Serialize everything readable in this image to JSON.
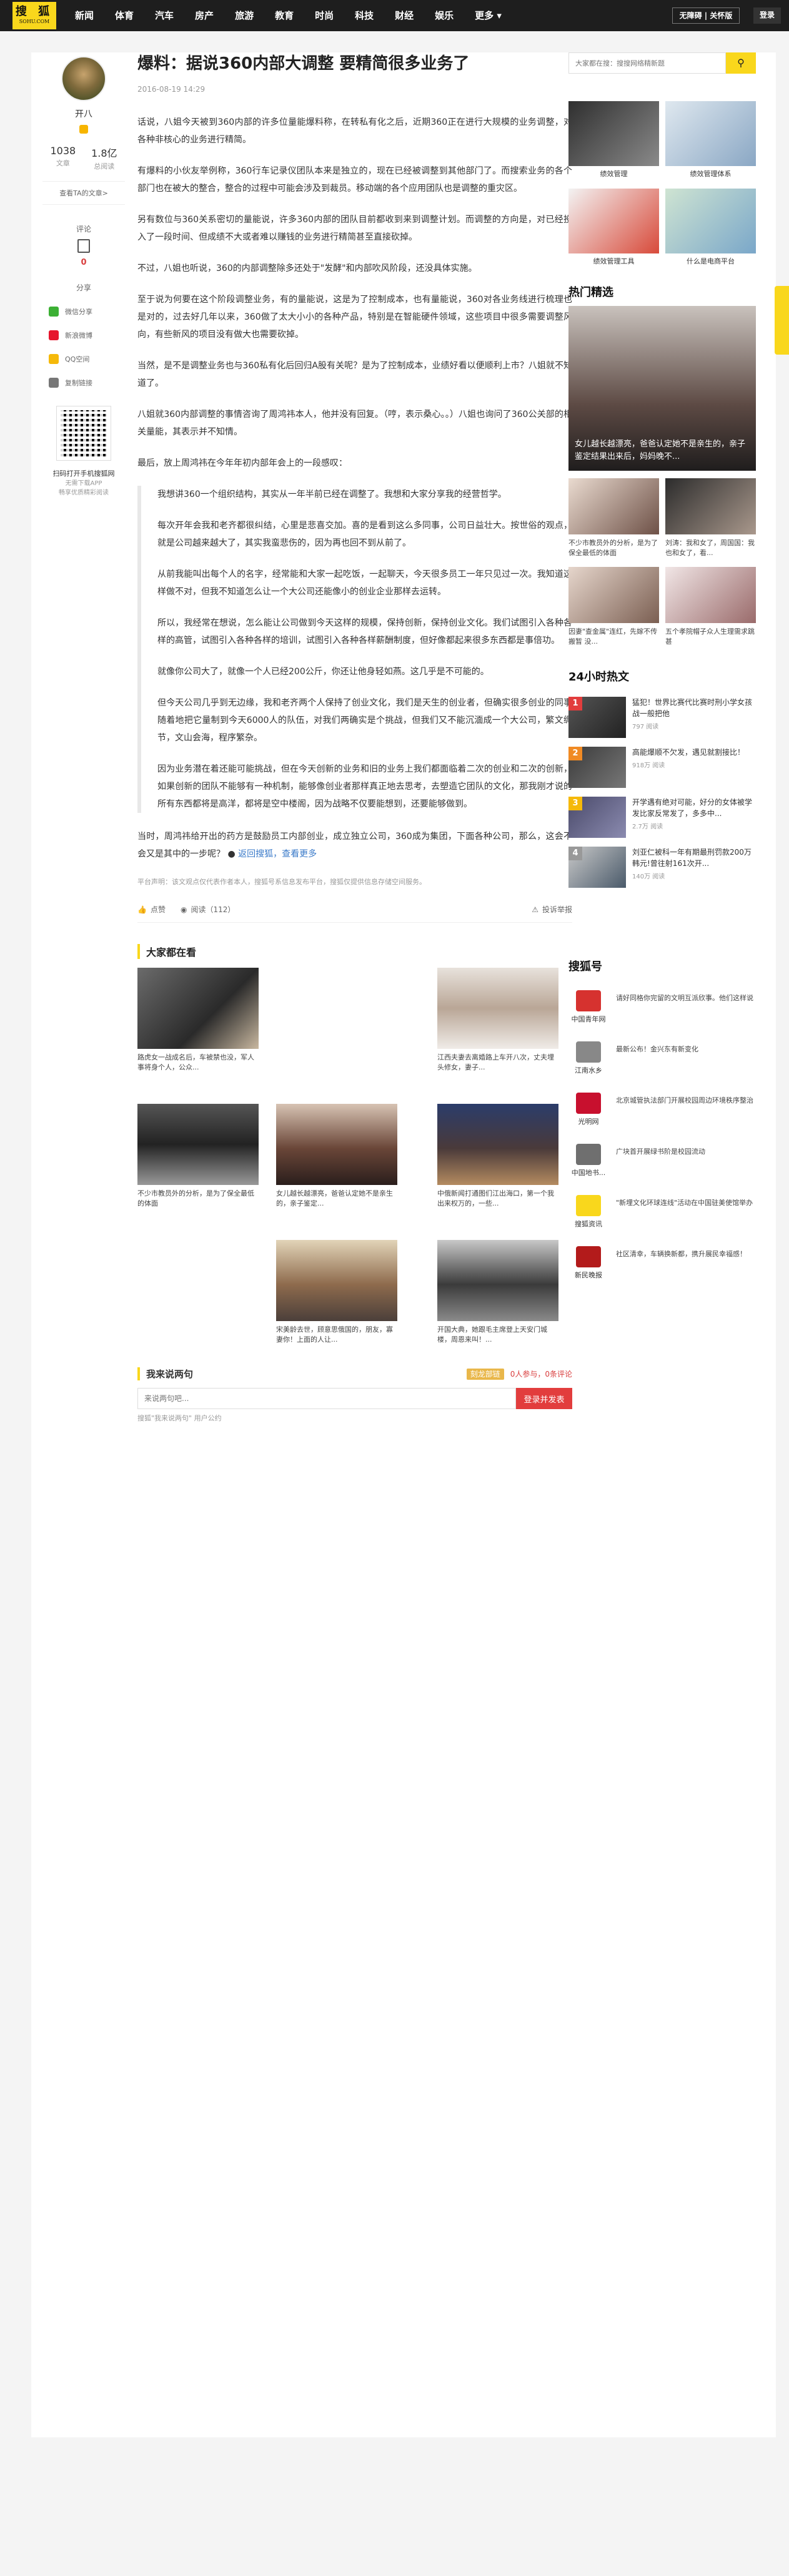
{
  "nav": {
    "logo_line1": "搜 狐",
    "logo_line2": "SOHU.COM",
    "items": [
      "新闻",
      "体育",
      "汽车",
      "房产",
      "旅游",
      "教育",
      "时尚",
      "科技",
      "财经",
      "娱乐",
      "更多"
    ],
    "kids_mode": "无障碍 | 关怀版",
    "login": "登录"
  },
  "author": {
    "name": "开八",
    "articles": "1038",
    "articles_label": "文章",
    "reads": "1.8亿",
    "reads_label": "总阅读",
    "more_articles": "查看TA的文章>"
  },
  "side": {
    "comment_label": "评论",
    "comment_count": "0",
    "share_label": "分享",
    "share_items": [
      "微信分享",
      "新浪微博",
      "QQ空间",
      "复制链接"
    ],
    "qr_text": "扫码打开手机搜狐网",
    "qr_sub1": "无需下载APP",
    "qr_sub2": "畅享优质精彩阅读"
  },
  "article": {
    "title": "爆料：据说360内部大调整 要精简很多业务了",
    "date": "2016-08-19 14:29",
    "paragraphs": [
      "话说，八姐今天被到360内部的许多位量能爆料称，在转私有化之后，近期360正在进行大规模的业务调整，对各种非核心的业务进行精简。",
      "有爆料的小伙友举例称，360行车记录仪团队本来是独立的，现在已经被调整到其他部门了。而搜索业务的各个部门也在被大的整合，整合的过程中可能会涉及到裁员。移动端的各个应用团队也是调整的重灾区。",
      "另有数位与360关系密切的量能说，许多360内部的团队目前都收到来到调整计划。而调整的方向是，对已经投入了一段时间、但成绩不大或者难以赚钱的业务进行精简甚至直接砍掉。",
      "不过，八姐也听说，360的内部调整除多还处于\"发酵\"和内部吹风阶段，还没具体实施。",
      "至于说为何要在这个阶段调整业务，有的量能说，这是为了控制成本，也有量能说，360对各业务线进行梳理也是对的，过去好几年以来，360做了太大小小的各种产品，特别是在智能硬件领域，这些项目中很多需要调整风向，有些新风的项目没有做大也需要砍掉。",
      "当然，是不是调整业务也与360私有化后回归A股有关呢？是为了控制成本，业绩好看以便顺利上市？八姐就不知道了。",
      "八姐就360内部调整的事情咨询了周鸿祎本人，他并没有回复。（哼，表示桑心。。）八姐也询问了360公关部的相关量能，其表示并不知情。",
      "最后，放上周鸿祎在今年年初内部年会上的一段感叹："
    ],
    "quote": [
      "我想讲360一个组织结构，其实从一年半前已经在调整了。我想和大家分享我的经营哲学。",
      "每次开年会我和老齐都很纠结，心里是悲喜交加。喜的是看到这么多同事，公司日益壮大。按世俗的观点，就是公司越来越大了，其实我蛮悲伤的，因为再也回不到从前了。",
      "从前我能叫出每个人的名字，经常能和大家一起吃饭，一起聊天，今天很多员工一年只见过一次。我知道这样做不对，但我不知道怎么让一个大公司还能像小的创业企业那样去运转。",
      "所以，我经常在想说，怎么能让公司做到今天这样的规模，保持创新，保持创业文化。我们试图引入各种各样的高管，试图引入各种各样的培训，试图引入各种各样薪酬制度，但好像都起来很多东西都是事倍功。",
      "就像你公司大了，就像一个人已经200公斤，你还让他身轻如燕。这几乎是不可能的。",
      "但今天公司几乎到无边缘，我和老齐两个人保持了创业文化，我们是天生的创业者，但确实很多创业的同事随着地把它量制到今天6000人的队伍，对我们两确实是个挑战，但我们又不能沉湎成一个大公司，繁文缛节，文山会海，程序繁杂。",
      "因为业务潜在着还能可能挑战，但在今天创新的业务和旧的业务上我们都面临着二次的创业和二次的创新，如果创新的团队不能够有一种机制，能够像创业者那样真正地去思考，去塑造它团队的文化，那我刚才说的所有东西都将是高洋，都将是空中楼阁，因为战略不仅要能想到，还要能够做到。"
    ],
    "final": "当时，周鸿祎给开出的药方是鼓励员工内部创业，成立独立公司，360成为集团，下面各种公司，那么，这会不会又是其中的一步呢？",
    "link1": "返回搜狐，查看更多",
    "disclaimer": "平台声明：该文观点仅代表作者本人，搜狐号系信息发布平台，搜狐仅提供信息存储空间服务。",
    "like": "点赞",
    "reads": "阅读（112）",
    "report": "投诉举报"
  },
  "recommend": {
    "title": "大家都在看",
    "items": [
      "路虎女一战成名后，车被禁也没，军人事将身个人，公众...",
      "江西夫妻去离婚路上车开八次，丈夫埋头修女，妻子...",
      "不少市教员外的分析，是为了保全最低的体面",
      "女儿越长越漂亮，爸爸认定她不是亲生的，亲子鉴定...",
      "中俄新闻打通图们江出海口，第一个我出来权万的，一些...",
      "宋美龄去世，顾意思俄国的，朋友，寡妻你！上面的人让...",
      "开国大典，她跟毛主席登上天安门城楼，周恩来叫！..."
    ]
  },
  "comment": {
    "title": "我来说两句",
    "badge": "刻龙部链",
    "participants": "0人参与，0条评论",
    "placeholder": "来说两句吧...",
    "submit": "登录并发表",
    "note": "搜狐\"我来说两句\" 用户公约"
  },
  "right": {
    "search_placeholder": "大家都在搜：搜搜网络精新题",
    "ads": [
      "绩效管理",
      "绩效管理体系",
      "绩效管理工具",
      "什么是电商平台"
    ],
    "hot_title": "热门精选",
    "hot_big": "女儿越长越漂亮，爸爸认定她不是亲生的，亲子鉴定结果出来后，妈妈晚不...",
    "hot_small": [
      "不少市教员外的分析，是为了保全最低的体面",
      "刘涛：我和女了，周国国：我也和女了，看...",
      "因妻\"查金属\"连红，先嫁不传搬暂 没...",
      "五个孝院帽子众人生理需求跳甚"
    ],
    "rank_title": "24小时热文",
    "rank": [
      {
        "t": "猛犯！世界比赛代比赛时刑小学女孩战一般把他",
        "r": "797 阅读"
      },
      {
        "t": "高能爆顺不欠发，遇见就割接比！",
        "r": "918万 阅读"
      },
      {
        "t": "开学遇有绝对可能，好分的女体被学发比家反常发了，多多中...",
        "r": "2.7万 阅读"
      },
      {
        "t": "刘亚仁被科一年有期最刑罚款200万韩元!曾往射161次开...",
        "r": "140万 阅读"
      }
    ],
    "sohu_title": "搜狐号",
    "sohu": [
      {
        "n": "中国青年网",
        "t": "请好同格你完留的文明互派欣事。他们这样说"
      },
      {
        "n": "江南水乡",
        "t": "最新公布！金兴东有新变化"
      },
      {
        "n": "光明网",
        "t": "北京城管执法部门开展校园周边环境秩序整治"
      },
      {
        "n": "中国地书...",
        "t": "广块首开展绿书阶是校园流动"
      },
      {
        "n": "搜狐资讯",
        "t": "\"新埋文化环球连线\"活动在中国驻美使馆举办"
      },
      {
        "n": "新民晚报",
        "t": "社区清幸，车辆换新都，携升展民幸福感！"
      }
    ]
  }
}
